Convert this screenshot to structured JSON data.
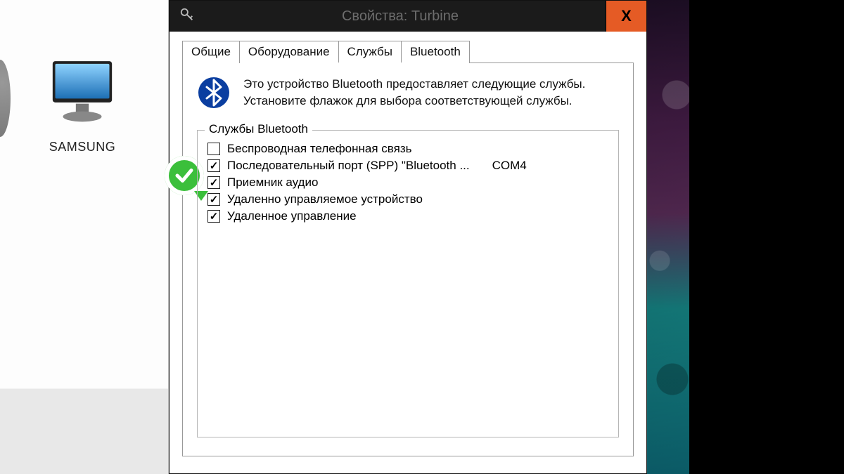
{
  "desktop": {
    "icon_label": "SAMSUNG"
  },
  "dialog": {
    "title": "Свойства: Turbine",
    "close_glyph": "X",
    "tabs": [
      "Общие",
      "Оборудование",
      "Службы",
      "Bluetooth"
    ],
    "active_tab_index": 2,
    "description_line1": "Это устройство Bluetooth предоставляет следующие службы.",
    "description_line2": "Установите флажок для выбора соответствующей службы.",
    "groupbox_title": "Службы Bluetooth",
    "services": [
      {
        "label": "Беспроводная телефонная связь",
        "checked": false,
        "port": ""
      },
      {
        "label": "Последовательный порт (SPP) \"Bluetooth ...",
        "checked": true,
        "port": "COM4"
      },
      {
        "label": "Приемник аудио",
        "checked": true,
        "port": ""
      },
      {
        "label": "Удаленно управляемое устройство",
        "checked": true,
        "port": ""
      },
      {
        "label": "Удаленное управление",
        "checked": true,
        "port": ""
      }
    ]
  }
}
